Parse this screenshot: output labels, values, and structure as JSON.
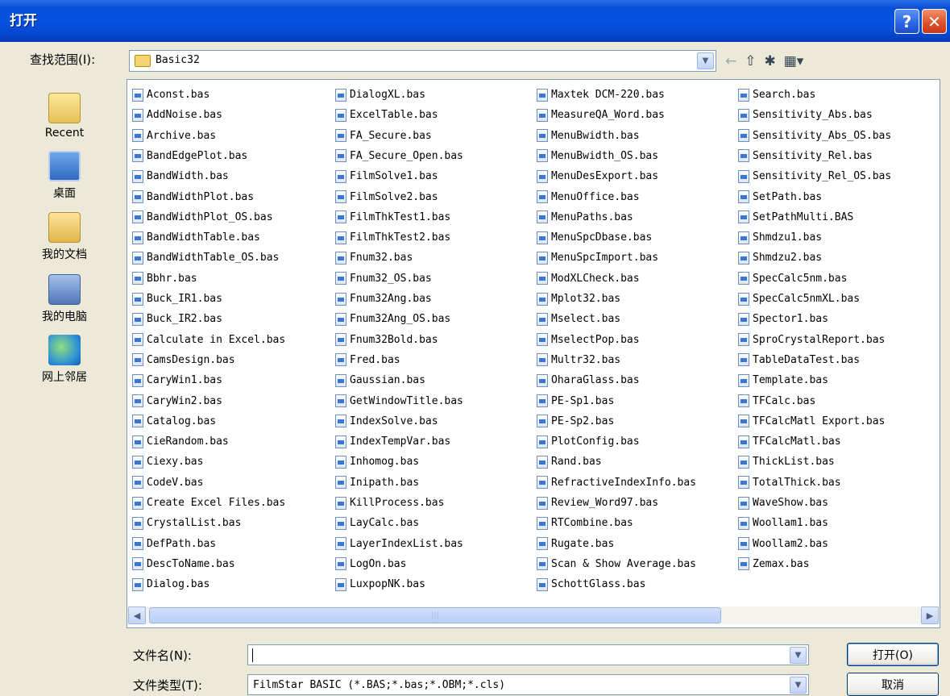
{
  "window": {
    "title": "打开",
    "help_glyph": "?",
    "close_glyph": "✕"
  },
  "lookin": {
    "label": "查找范围(I):",
    "value": "Basic32"
  },
  "places": {
    "recent": "Recent",
    "desktop": "桌面",
    "documents": "我的文档",
    "computer": "我的电脑",
    "network": "网上邻居"
  },
  "files": [
    [
      "Aconst.bas",
      "AddNoise.bas",
      "Archive.bas",
      "BandEdgePlot.bas",
      "BandWidth.bas",
      "BandWidthPlot.bas",
      "BandWidthPlot_OS.bas",
      "BandWidthTable.bas",
      "BandWidthTable_OS.bas",
      "Bbhr.bas",
      "Buck_IR1.bas",
      "Buck_IR2.bas",
      "Calculate in Excel.bas",
      "CamsDesign.bas",
      "CaryWin1.bas",
      "CaryWin2.bas",
      "Catalog.bas",
      "CieRandom.bas",
      "Ciexy.bas",
      "CodeV.bas",
      "Create Excel Files.bas",
      "CrystalList.bas",
      "DefPath.bas",
      "DescToName.bas",
      "Dialog.bas"
    ],
    [
      "DialogXL.bas",
      "ExcelTable.bas",
      "FA_Secure.bas",
      "FA_Secure_Open.bas",
      "FilmSolve1.bas",
      "FilmSolve2.bas",
      "FilmThkTest1.bas",
      "FilmThkTest2.bas",
      "Fnum32.bas",
      "Fnum32_OS.bas",
      "Fnum32Ang.bas",
      "Fnum32Ang_OS.bas",
      "Fnum32Bold.bas",
      "Fred.bas",
      "Gaussian.bas",
      "GetWindowTitle.bas",
      "IndexSolve.bas",
      "IndexTempVar.bas",
      "Inhomog.bas",
      "Inipath.bas",
      "KillProcess.bas",
      "LayCalc.bas",
      "LayerIndexList.bas",
      "LogOn.bas",
      "LuxpopNK.bas"
    ],
    [
      "Maxtek DCM-220.bas",
      "MeasureQA_Word.bas",
      "MenuBwidth.bas",
      "MenuBwidth_OS.bas",
      "MenuDesExport.bas",
      "MenuOffice.bas",
      "MenuPaths.bas",
      "MenuSpcDbase.bas",
      "MenuSpcImport.bas",
      "ModXLCheck.bas",
      "Mplot32.bas",
      "Mselect.bas",
      "MselectPop.bas",
      "Multr32.bas",
      "OharaGlass.bas",
      "PE-Sp1.bas",
      "PE-Sp2.bas",
      "PlotConfig.bas",
      "Rand.bas",
      "RefractiveIndexInfo.bas",
      "Review_Word97.bas",
      "RTCombine.bas",
      "Rugate.bas",
      "Scan & Show Average.bas",
      "SchottGlass.bas"
    ],
    [
      "Search.bas",
      "Sensitivity_Abs.bas",
      "Sensitivity_Abs_OS.bas",
      "Sensitivity_Rel.bas",
      "Sensitivity_Rel_OS.bas",
      "SetPath.bas",
      "SetPathMulti.BAS",
      "Shmdzu1.bas",
      "Shmdzu2.bas",
      "SpecCalc5nm.bas",
      "SpecCalc5nmXL.bas",
      "Spector1.bas",
      "SproCrystalReport.bas",
      "TableDataTest.bas",
      "Template.bas",
      "TFCalc.bas",
      "TFCalcMatl Export.bas",
      "TFCalcMatl.bas",
      "ThickList.bas",
      "TotalThick.bas",
      "WaveShow.bas",
      "Woollam1.bas",
      "Woollam2.bas",
      "Zemax.bas"
    ]
  ],
  "scroll": {
    "left_arrow": "◀",
    "right_arrow": "▶",
    "thumb_grip": "|||"
  },
  "filename": {
    "label": "文件名(N):",
    "value": ""
  },
  "filetype": {
    "label": "文件类型(T):",
    "value": "FilmStar BASIC (*.BAS;*.bas;*.OBM;*.cls)"
  },
  "buttons": {
    "open": "打开(O)",
    "cancel": "取消"
  },
  "toolbar": {
    "back_glyph": "←",
    "up_glyph": "⇧",
    "newfolder_glyph": "✱",
    "views_glyph": "▦▾"
  },
  "combo_arrow_glyph": "▼"
}
